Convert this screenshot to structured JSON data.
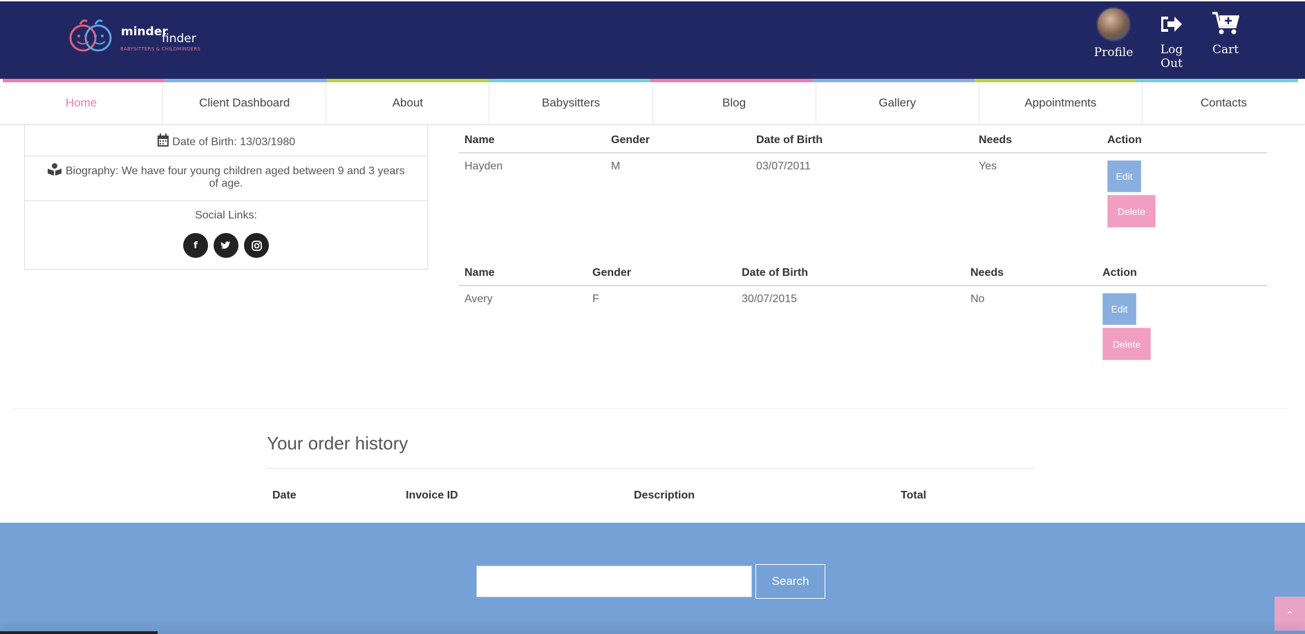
{
  "brand": {
    "name_part1": "minder",
    "name_part2": "finder",
    "tagline": "BABYSITTERS & CHILDMINDERS"
  },
  "top_actions": {
    "profile_label": "Profile",
    "logout_label": "Log Out",
    "cart_label": "Cart"
  },
  "colorbar": [
    "#e57fb0",
    "#89aee0",
    "#b8d34a",
    "#7fcad8",
    "#e57fb0",
    "#89aee0",
    "#b8d34a",
    "#7fcad8"
  ],
  "nav": {
    "items": [
      {
        "label": "Home"
      },
      {
        "label": "Client Dashboard"
      },
      {
        "label": "About"
      },
      {
        "label": "Babysitters"
      },
      {
        "label": "Blog"
      },
      {
        "label": "Gallery"
      },
      {
        "label": "Appointments"
      },
      {
        "label": "Contacts"
      }
    ],
    "active_index": 0
  },
  "profile": {
    "dob": "Date of Birth: 13/03/1980",
    "bio": "Biography: We have four young children aged between 9 and 3 years of age.",
    "social_label": "Social Links:",
    "social_icons": [
      "facebook-icon",
      "twitter-icon",
      "instagram-icon"
    ]
  },
  "children": {
    "headers": [
      "Name",
      "Gender",
      "Date of Birth",
      "Needs",
      "Action"
    ],
    "rows": [
      {
        "name": "Hayden",
        "gender": "M",
        "dob": "03/07/2011",
        "needs": "Yes"
      },
      {
        "name": "Avery",
        "gender": "F",
        "dob": "30/07/2015",
        "needs": "No"
      }
    ],
    "edit_label": "Edit",
    "delete_label": "Delete"
  },
  "orders": {
    "title": "Your order history",
    "headers": [
      "Date",
      "Invoice ID",
      "Description",
      "Total"
    ]
  },
  "footer": {
    "search_button": "Search",
    "search_placeholder": "",
    "to_top_icon": "chevron-up-icon"
  },
  "colors": {
    "topbar": "#212762",
    "accent_pink": "#e47fb0",
    "accent_blue": "#89aee0",
    "footer": "#75a1d6"
  }
}
